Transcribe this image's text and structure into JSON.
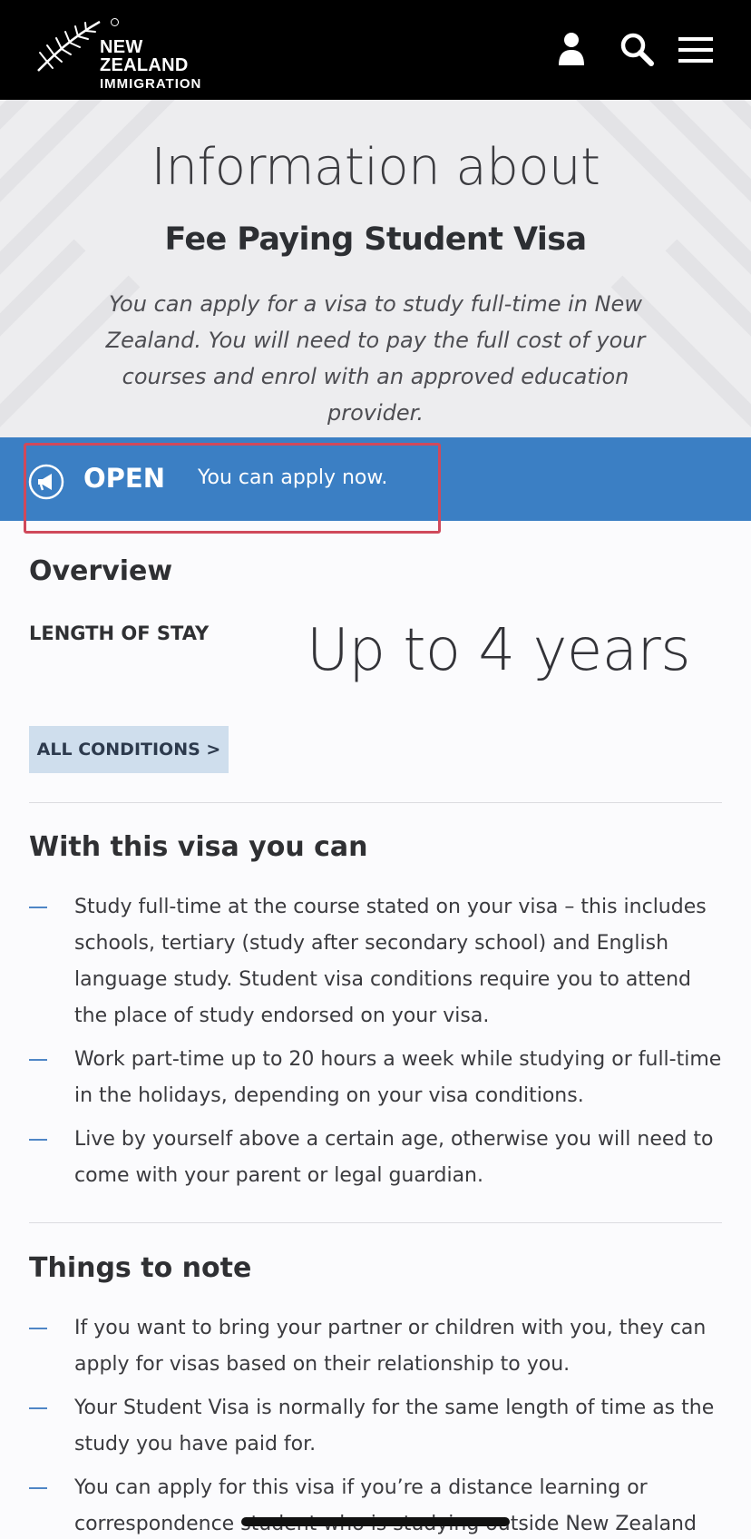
{
  "header": {
    "brand_line1": "NEW ZEALAND",
    "brand_line2": "IMMIGRATION",
    "icons": [
      "fern-logo-icon",
      "user-icon",
      "search-icon",
      "menu-icon"
    ]
  },
  "hero": {
    "intro": "Information about",
    "title": "Fee Paying Student Visa",
    "description": "You can apply for a visa to study full-time in New Zealand. You will need to pay the full cost of your courses and enrol with an approved education provider."
  },
  "status": {
    "icon": "megaphone-icon",
    "label": "OPEN",
    "text": "You can apply now.",
    "color": "#3b7fc4"
  },
  "overview": {
    "heading": "Overview",
    "length_of_stay_label": "LENGTH OF STAY",
    "length_of_stay_value": "Up to 4 years",
    "conditions_button": "ALL CONDITIONS >"
  },
  "with_visa": {
    "heading": "With this visa you can",
    "items": [
      "Study full-time at the course stated on your visa – this includes schools, tertiary (study after secondary school) and English language study. Student visa conditions require you to attend the place of study endorsed on your visa.",
      "Work part-time up to 20 hours a week while studying or full-time in the holidays, depending on your visa conditions.",
      "Live by yourself above a certain age, otherwise you will need to come with your parent or legal guardian."
    ]
  },
  "things_to_note": {
    "heading": "Things to note",
    "items": [
      "If you want to bring your partner or children with you, they can apply for visas based on their relationship to you.",
      "Your Student Visa is normally for the same length of time as the study you have paid for.",
      "You can apply for this visa if you’re a distance learning or correspondence student who is studying outside New Zealand"
    ]
  },
  "colors": {
    "header_bg": "#000000",
    "hero_bg": "#ededef",
    "accent_blue": "#3b7fc4",
    "button_bg": "#cfdeed",
    "highlight": "#d0495b"
  }
}
